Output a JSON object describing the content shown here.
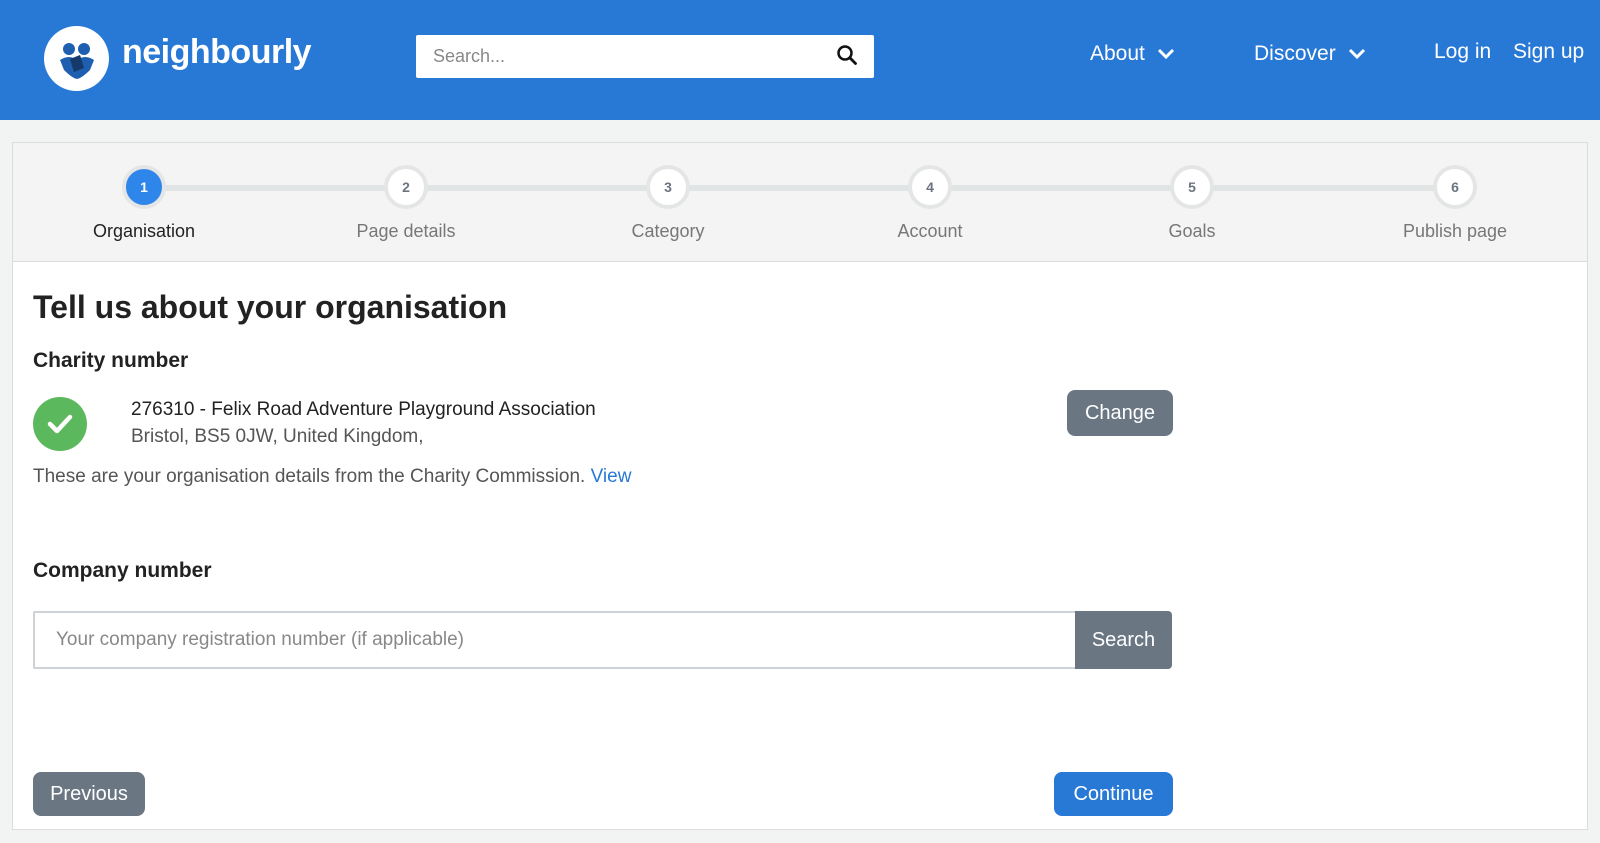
{
  "header": {
    "brand": "neighbourly",
    "search_placeholder": "Search...",
    "nav": {
      "about": "About",
      "discover": "Discover",
      "login": "Log in",
      "signup": "Sign up"
    },
    "color": "#2878d6"
  },
  "stepper": {
    "steps": [
      {
        "number": "1",
        "label": "Organisation",
        "active": true
      },
      {
        "number": "2",
        "label": "Page details",
        "active": false
      },
      {
        "number": "3",
        "label": "Category",
        "active": false
      },
      {
        "number": "4",
        "label": "Account",
        "active": false
      },
      {
        "number": "5",
        "label": "Goals",
        "active": false
      },
      {
        "number": "6",
        "label": "Publish page",
        "active": false
      }
    ]
  },
  "form": {
    "title": "Tell us about your organisation",
    "charity": {
      "label": "Charity number",
      "name": "276310 - Felix Road Adventure Playground Association",
      "address": "Bristol, BS5 0JW, United Kingdom,",
      "change_button": "Change",
      "info_text": "These are your organisation details from the Charity Commission.",
      "view_link": "View",
      "status_color": "#5cb85c"
    },
    "company": {
      "label": "Company number",
      "placeholder": "Your company registration number (if applicable)",
      "value": "",
      "search_button": "Search"
    },
    "previous_button": "Previous",
    "continue_button": "Continue"
  }
}
